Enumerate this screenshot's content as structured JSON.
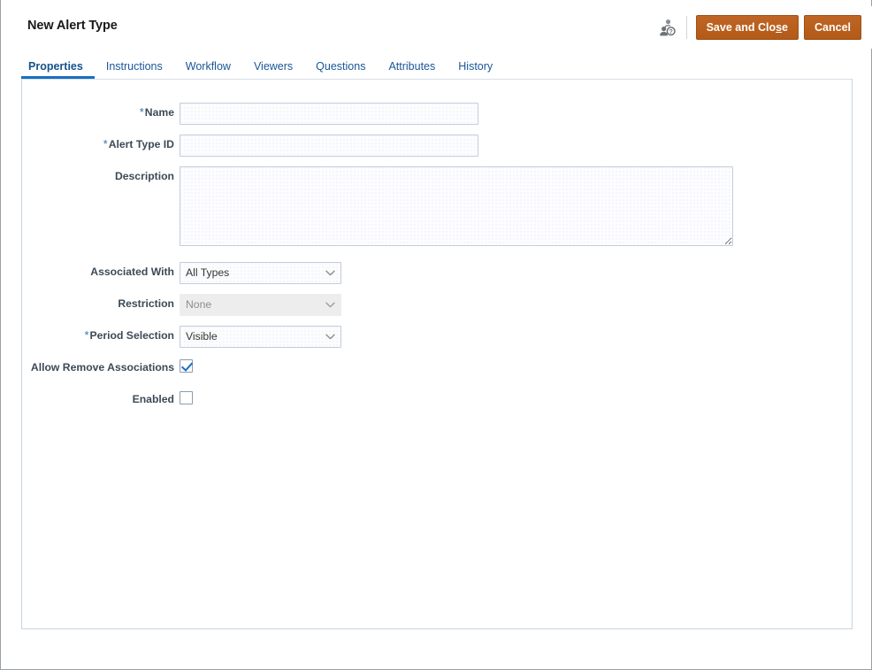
{
  "window": {
    "title": "New Alert Type"
  },
  "header": {
    "title": "New Alert Type",
    "user_icon": "user-question-icon",
    "buttons": {
      "save_and_close": {
        "label_before": "Save and Clo",
        "label_underlined": "s",
        "label_after": "e",
        "full_label": "Save and Close"
      },
      "cancel": {
        "label": "Cancel"
      }
    }
  },
  "tabs": [
    {
      "label": "Properties",
      "active": true
    },
    {
      "label": "Instructions",
      "active": false
    },
    {
      "label": "Workflow",
      "active": false
    },
    {
      "label": "Viewers",
      "active": false
    },
    {
      "label": "Questions",
      "active": false
    },
    {
      "label": "Attributes",
      "active": false
    },
    {
      "label": "History",
      "active": false
    }
  ],
  "form": {
    "name": {
      "label": "Name",
      "required": true,
      "required_marker": "*",
      "value": "",
      "placeholder": ""
    },
    "alert_type_id": {
      "label": "Alert Type ID",
      "required": true,
      "required_marker": "*",
      "value": "",
      "placeholder": ""
    },
    "description": {
      "label": "Description",
      "required": false,
      "value": "",
      "placeholder": ""
    },
    "associated_with": {
      "label": "Associated With",
      "required": false,
      "value": "All Types",
      "options": [
        "All Types"
      ],
      "disabled": false
    },
    "restriction": {
      "label": "Restriction",
      "required": false,
      "value": "None",
      "options": [
        "None"
      ],
      "disabled": true
    },
    "period_selection": {
      "label": "Period Selection",
      "required": true,
      "required_marker": "*",
      "value": "Visible",
      "options": [
        "Visible"
      ],
      "disabled": false
    },
    "allow_remove_associations": {
      "label": "Allow Remove Associations",
      "checked": true
    },
    "enabled": {
      "label": "Enabled",
      "checked": false
    }
  },
  "colors": {
    "button_accent": "#b85c1e",
    "tab_active": "#1b6ec2",
    "link_blue": "#1a5699",
    "required_asterisk": "#3b6fa8",
    "label_text": "#3c4a57",
    "panel_border": "#c8d4e0"
  }
}
